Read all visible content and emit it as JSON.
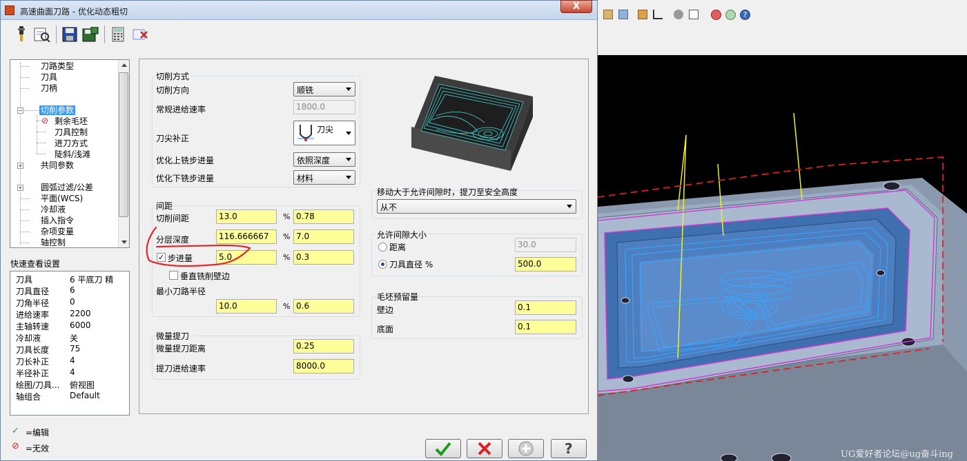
{
  "dialog": {
    "title": "高速曲面刀路 - 优化动态粗切",
    "close_label": "X"
  },
  "tree": {
    "items": [
      "刀路类型",
      "刀具",
      "刀柄",
      "切削参数",
      "剩余毛坯",
      "刀具控制",
      "进刀方式",
      "陡斜/浅滩",
      "共同参数",
      "圆弧过滤/公差",
      "平面(WCS)",
      "冷却液",
      "插入指令",
      "杂项变量",
      "轴控制"
    ]
  },
  "quick_view": {
    "label": "快速查看设置",
    "rows": [
      {
        "k": "刀具",
        "v": "6 平底刀 精"
      },
      {
        "k": "刀具直径",
        "v": "6"
      },
      {
        "k": "刀角半径",
        "v": "0"
      },
      {
        "k": "进给速率",
        "v": "2200"
      },
      {
        "k": "主轴转速",
        "v": "6000"
      },
      {
        "k": "冷却液",
        "v": "关"
      },
      {
        "k": "刀具长度",
        "v": "75"
      },
      {
        "k": "刀长补正",
        "v": "4"
      },
      {
        "k": "半径补正",
        "v": "4"
      },
      {
        "k": "绘图/刀具...",
        "v": "俯视图"
      },
      {
        "k": "轴组合",
        "v": "Default"
      }
    ]
  },
  "legend": {
    "edit": "=编辑",
    "invalid": "=无效"
  },
  "cut_method": {
    "group": "切削方式",
    "direction_label": "切削方向",
    "direction_value": "顺铣",
    "feed_label": "常规进给速率",
    "feed_value": "1800.0",
    "tip_comp_label": "刀尖补正",
    "tip_comp_value": "刀尖",
    "opt_up_label": "优化上铣步进量",
    "opt_up_value": "依照深度",
    "opt_down_label": "优化下铣步进量",
    "opt_down_value": "材料"
  },
  "spacing": {
    "group": "间距",
    "stepover_label": "切削间距",
    "stepover_value": "13.0",
    "stepover_pct": "0.78",
    "depth_label": "分层深度",
    "depth_value": "116.666667",
    "depth_pct": "7.0",
    "step_label": "步进量",
    "step_value": "5.0",
    "step_pct": "0.3",
    "vertical_label": "垂直铣削壁边",
    "min_radius_label": "最小刀路半径",
    "min_radius_value": "10.0",
    "min_radius_pct": "0.6",
    "pct_symbol": "%"
  },
  "micro_lift": {
    "group": "微量提刀",
    "dist_label": "微量提刀距离",
    "dist_value": "0.25",
    "feed_label": "提刀进给速率",
    "feed_value": "8000.0"
  },
  "retract": {
    "label": "移动大于允许间隙时，提刀至安全高度",
    "value": "从不"
  },
  "gap": {
    "group": "允许间隙大小",
    "distance_label": "距离",
    "distance_value": "30.0",
    "tooldia_label": "刀具直径 %",
    "tooldia_value": "500.0"
  },
  "stock": {
    "group": "毛坯预留量",
    "wall_label": "壁边",
    "wall_value": "0.1",
    "floor_label": "底面",
    "floor_value": "0.1"
  },
  "watermark": "UG爱好者论坛@ug奋斗ing",
  "colors": {
    "field_yellow": "#ffff99",
    "selection": "#3399ff",
    "toolpath": "#3aa0ff",
    "annotation": "#e02020"
  }
}
